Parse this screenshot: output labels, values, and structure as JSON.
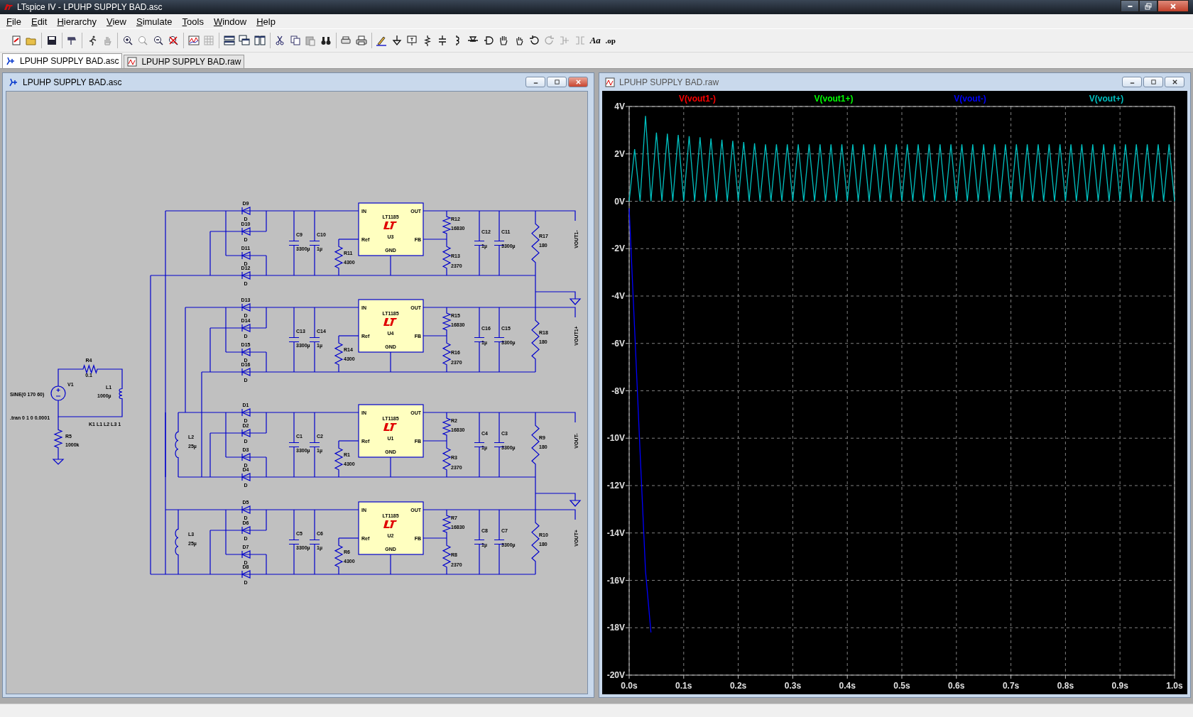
{
  "window": {
    "title": "LTspice IV - LPUHP SUPPLY BAD.asc"
  },
  "menu": [
    "File",
    "Edit",
    "Hierarchy",
    "View",
    "Simulate",
    "Tools",
    "Window",
    "Help"
  ],
  "toolbar_text_buttons": [
    "Aa",
    ".op"
  ],
  "tabs": [
    {
      "label": "LPUHP SUPPLY BAD.asc",
      "selected": true,
      "kind": "schematic"
    },
    {
      "label": "LPUHP SUPPLY BAD.raw",
      "selected": false,
      "kind": "waveform"
    }
  ],
  "schematic_window": {
    "title": "LPUHP SUPPLY BAD.asc",
    "input_circuit": {
      "source": {
        "name": "V1",
        "value": "SINE(0 170 60)"
      },
      "series_resistor": {
        "name": "R4",
        "value": "0.1"
      },
      "primary": {
        "name": "L1",
        "value": "1000µ"
      },
      "bleeder": {
        "name": "R5",
        "value": "1000k"
      },
      "directives": [
        ".tran 0 1 0 0.0001",
        "K1 L1 L2 L3 1"
      ]
    },
    "stages": [
      {
        "diodes": [
          {
            "name": "D9",
            "model": "D"
          },
          {
            "name": "D10",
            "model": "D"
          },
          {
            "name": "D11",
            "model": "D"
          },
          {
            "name": "D12",
            "model": "D"
          }
        ],
        "input_caps": [
          {
            "name": "C9",
            "value": "3300µ"
          },
          {
            "name": "C10",
            "value": "1µ"
          }
        ],
        "ref_resistor": {
          "name": "R11",
          "value": "4300"
        },
        "regulator": {
          "part": "LT1185",
          "ref": "U3",
          "pin_in": "IN",
          "pin_out": "OUT",
          "pin_ref": "Ref",
          "pin_fb": "FB",
          "pin_gnd": "GND"
        },
        "divider": [
          {
            "name": "R12",
            "value": "16830"
          },
          {
            "name": "R13",
            "value": "2370"
          }
        ],
        "output_caps": [
          {
            "name": "C12",
            "value": "1µ"
          },
          {
            "name": "C11",
            "value": "3300µ"
          }
        ],
        "load": {
          "name": "R17",
          "value": "180"
        },
        "net_label": "VOUT1-",
        "ground": true
      },
      {
        "diodes": [
          {
            "name": "D13",
            "model": "D"
          },
          {
            "name": "D14",
            "model": "D"
          },
          {
            "name": "D15",
            "model": "D"
          },
          {
            "name": "D16",
            "model": "D"
          }
        ],
        "input_caps": [
          {
            "name": "C13",
            "value": "3300µ"
          },
          {
            "name": "C14",
            "value": "1µ"
          }
        ],
        "ref_resistor": {
          "name": "R14",
          "value": "4300"
        },
        "regulator": {
          "part": "LT1185",
          "ref": "U4",
          "pin_in": "IN",
          "pin_out": "OUT",
          "pin_ref": "Ref",
          "pin_fb": "FB",
          "pin_gnd": "GND"
        },
        "divider": [
          {
            "name": "R15",
            "value": "16830"
          },
          {
            "name": "R16",
            "value": "2370"
          }
        ],
        "output_caps": [
          {
            "name": "C16",
            "value": "1µ"
          },
          {
            "name": "C15",
            "value": "3300µ"
          }
        ],
        "load": {
          "name": "R18",
          "value": "180"
        },
        "net_label": "VOUT1+",
        "ground": false
      },
      {
        "inductor": {
          "name": "L2",
          "value": "25µ"
        },
        "diodes": [
          {
            "name": "D1",
            "model": "D"
          },
          {
            "name": "D2",
            "model": "D"
          },
          {
            "name": "D3",
            "model": "D"
          },
          {
            "name": "D4",
            "model": "D"
          }
        ],
        "input_caps": [
          {
            "name": "C1",
            "value": "3300µ"
          },
          {
            "name": "C2",
            "value": "1µ"
          }
        ],
        "ref_resistor": {
          "name": "R1",
          "value": "4300"
        },
        "regulator": {
          "part": "LT1185",
          "ref": "U1",
          "pin_in": "IN",
          "pin_out": "OUT",
          "pin_ref": "Ref",
          "pin_fb": "FB",
          "pin_gnd": "GND"
        },
        "divider": [
          {
            "name": "R2",
            "value": "16830"
          },
          {
            "name": "R3",
            "value": "2370"
          }
        ],
        "output_caps": [
          {
            "name": "C4",
            "value": "1µ"
          },
          {
            "name": "C3",
            "value": "3300µ"
          }
        ],
        "load": {
          "name": "R9",
          "value": "180"
        },
        "net_label": "VOUT-",
        "ground": true
      },
      {
        "inductor": {
          "name": "L3",
          "value": "25µ"
        },
        "diodes": [
          {
            "name": "D5",
            "model": "D"
          },
          {
            "name": "D6",
            "model": "D"
          },
          {
            "name": "D7",
            "model": "D"
          },
          {
            "name": "D8",
            "model": "D"
          }
        ],
        "input_caps": [
          {
            "name": "C5",
            "value": "3300µ"
          },
          {
            "name": "C6",
            "value": "1µ"
          }
        ],
        "ref_resistor": {
          "name": "R6",
          "value": "4300"
        },
        "regulator": {
          "part": "LT1185",
          "ref": "U2",
          "pin_in": "IN",
          "pin_out": "OUT",
          "pin_ref": "Ref",
          "pin_fb": "FB",
          "pin_gnd": "GND"
        },
        "divider": [
          {
            "name": "R7",
            "value": "16830"
          },
          {
            "name": "R8",
            "value": "2370"
          }
        ],
        "output_caps": [
          {
            "name": "C8",
            "value": "1µ"
          },
          {
            "name": "C7",
            "value": "3300µ"
          }
        ],
        "load": {
          "name": "R10",
          "value": "180"
        },
        "net_label": "VOUT+",
        "ground": false
      }
    ]
  },
  "waveform_window": {
    "title": "LPUHP SUPPLY BAD.raw",
    "chart_data": {
      "type": "line",
      "x": [
        0,
        0.01,
        0.02,
        0.03,
        0.04,
        0.05,
        0.06,
        0.07,
        0.08,
        0.09,
        0.1,
        0.11,
        0.12,
        0.13,
        0.14,
        0.15,
        0.16,
        0.17,
        0.18,
        0.19,
        0.2,
        0.21,
        0.22,
        0.23,
        0.24,
        0.25,
        0.26,
        0.27,
        0.28,
        0.29,
        0.3,
        0.31,
        0.32,
        0.33,
        0.34,
        0.35,
        0.36,
        0.37,
        0.38,
        0.39,
        0.4,
        0.41,
        0.42,
        0.43,
        0.44,
        0.45,
        0.46,
        0.47,
        0.48,
        0.49,
        0.5,
        0.51,
        0.52,
        0.53,
        0.54,
        0.55,
        0.56,
        0.57,
        0.58,
        0.59,
        0.6,
        0.61,
        0.62,
        0.63,
        0.64,
        0.65,
        0.66,
        0.67,
        0.68,
        0.69,
        0.7,
        0.71,
        0.72,
        0.73,
        0.74,
        0.75,
        0.76,
        0.77,
        0.78,
        0.79,
        0.8,
        0.81,
        0.82,
        0.83,
        0.84,
        0.85,
        0.86,
        0.87,
        0.88,
        0.89,
        0.9,
        0.91,
        0.92,
        0.93,
        0.94,
        0.95,
        0.96,
        0.97,
        0.98,
        0.99,
        1
      ],
      "series": [
        {
          "name": "V(vout1-)",
          "color": "#ff0000",
          "values": [
            null,
            null,
            null,
            null,
            null,
            null,
            null,
            null,
            null,
            null,
            null,
            null,
            null,
            null,
            null,
            null,
            null,
            null,
            null,
            null,
            null,
            null,
            null,
            null,
            null,
            null,
            null,
            null,
            null,
            null,
            null,
            null,
            null,
            null,
            null,
            null,
            null,
            null,
            null,
            null,
            null,
            null,
            null,
            null,
            null,
            null,
            null,
            null,
            null,
            null,
            null,
            null,
            null,
            null,
            null,
            null,
            null,
            null,
            null,
            null,
            null,
            null,
            null,
            null,
            null,
            null,
            null,
            null,
            null,
            null,
            null,
            null,
            null,
            null,
            null,
            null,
            null,
            null,
            null,
            null,
            null,
            null,
            null,
            null,
            null,
            null,
            null,
            null,
            null,
            null,
            null,
            null,
            null,
            null,
            null,
            null,
            null,
            null,
            null,
            null,
            null
          ]
        },
        {
          "name": "V(vout1+)",
          "color": "#00ff00",
          "values": [
            null,
            null,
            null,
            null,
            null,
            null,
            null,
            null,
            null,
            null,
            null,
            null,
            null,
            null,
            null,
            null,
            null,
            null,
            null,
            null,
            null,
            null,
            null,
            null,
            null,
            null,
            null,
            null,
            null,
            null,
            null,
            null,
            null,
            null,
            null,
            null,
            null,
            null,
            null,
            null,
            null,
            null,
            null,
            null,
            null,
            null,
            null,
            null,
            null,
            null,
            null,
            null,
            null,
            null,
            null,
            null,
            null,
            null,
            null,
            null,
            null,
            null,
            null,
            null,
            null,
            null,
            null,
            null,
            null,
            null,
            null,
            null,
            null,
            null,
            null,
            null,
            null,
            null,
            null,
            null,
            null,
            null,
            null,
            null,
            null,
            null,
            null,
            null,
            null,
            null,
            null,
            null,
            null,
            null,
            null,
            null,
            null,
            null,
            null,
            null,
            null
          ]
        },
        {
          "name": "V(vout-)",
          "color": "#0000ff",
          "values": [
            -0.3,
            -5.4,
            -10.6,
            -15.6,
            -18.2,
            null,
            null,
            null,
            null,
            null,
            null,
            null,
            null,
            null,
            null,
            null,
            null,
            null,
            null,
            null,
            null,
            null,
            null,
            null,
            null,
            null,
            null,
            null,
            null,
            null,
            null,
            null,
            null,
            null,
            null,
            null,
            null,
            null,
            null,
            null,
            null,
            null,
            null,
            null,
            null,
            null,
            null,
            null,
            null,
            null,
            null,
            null,
            null,
            null,
            null,
            null,
            null,
            null,
            null,
            null,
            null,
            null,
            null,
            null,
            null,
            null,
            null,
            null,
            null,
            null,
            null,
            null,
            null,
            null,
            null,
            null,
            null,
            null,
            null,
            null,
            null,
            null,
            null,
            null,
            null,
            null,
            null,
            null,
            null,
            null,
            null,
            null,
            null,
            null,
            null,
            null,
            null,
            null,
            null,
            null,
            null
          ]
        },
        {
          "name": "V(vout+)",
          "color": "#00c0c0",
          "values": [
            0,
            2.2,
            0,
            3.6,
            0,
            2.9,
            0,
            2.85,
            0,
            2.8,
            0,
            2.75,
            0,
            2.7,
            0,
            2.65,
            0,
            2.6,
            0,
            2.55,
            0,
            2.5,
            0,
            2.45,
            0,
            2.4,
            0,
            2.4,
            0,
            2.4,
            0,
            2.4,
            0,
            2.4,
            0,
            2.4,
            0,
            2.4,
            0,
            2.4,
            0,
            2.4,
            0,
            2.4,
            0,
            2.4,
            0,
            2.4,
            0,
            2.4,
            0,
            2.4,
            0,
            2.4,
            0,
            2.4,
            0,
            2.4,
            0,
            2.4,
            0,
            2.4,
            0,
            2.4,
            0,
            2.4,
            0,
            2.4,
            0,
            2.4,
            0,
            2.4,
            0,
            2.4,
            0,
            2.4,
            0,
            2.4,
            0,
            2.4,
            0,
            2.4,
            0,
            2.4,
            0,
            2.4,
            0,
            2.4,
            0,
            2.4,
            0,
            2.4,
            0,
            2.4,
            0,
            2.4,
            0,
            2.4,
            0,
            2.4,
            0
          ]
        }
      ],
      "xlim": [
        0,
        1
      ],
      "ylim": [
        -20,
        4
      ],
      "grid": true,
      "xticks": [
        {
          "value": 0,
          "label": "0.0s"
        },
        {
          "value": 0.1,
          "label": "0.1s"
        },
        {
          "value": 0.2,
          "label": "0.2s"
        },
        {
          "value": 0.3,
          "label": "0.3s"
        },
        {
          "value": 0.4,
          "label": "0.4s"
        },
        {
          "value": 0.5,
          "label": "0.5s"
        },
        {
          "value": 0.6,
          "label": "0.6s"
        },
        {
          "value": 0.7,
          "label": "0.7s"
        },
        {
          "value": 0.8,
          "label": "0.8s"
        },
        {
          "value": 0.9,
          "label": "0.9s"
        },
        {
          "value": 1,
          "label": "1.0s"
        }
      ],
      "yticks": [
        {
          "value": 4,
          "label": "4V"
        },
        {
          "value": 2,
          "label": "2V"
        },
        {
          "value": 0,
          "label": "0V"
        },
        {
          "value": -2,
          "label": "-2V"
        },
        {
          "value": -4,
          "label": "-4V"
        },
        {
          "value": -6,
          "label": "-6V"
        },
        {
          "value": -8,
          "label": "-8V"
        },
        {
          "value": -10,
          "label": "-10V"
        },
        {
          "value": -12,
          "label": "-12V"
        },
        {
          "value": -14,
          "label": "-14V"
        },
        {
          "value": -16,
          "label": "-16V"
        },
        {
          "value": -18,
          "label": "-18V"
        },
        {
          "value": -20,
          "label": "-20V"
        }
      ]
    }
  }
}
